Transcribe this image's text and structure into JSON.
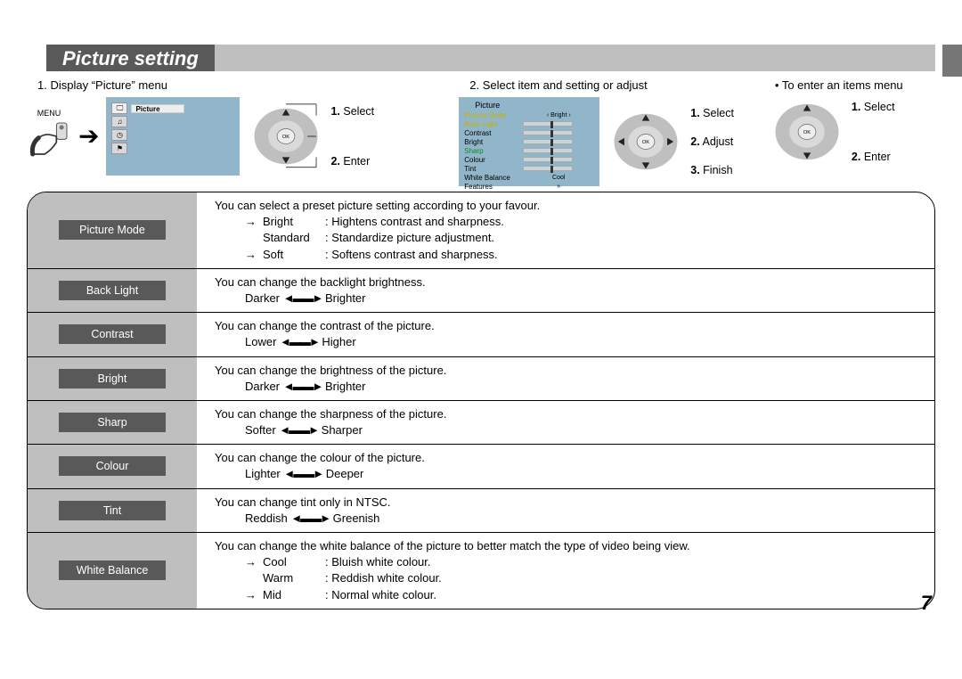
{
  "title": "Picture setting",
  "page_number": "7",
  "step1": {
    "label": "1. Display “Picture” menu",
    "menu_label": "MENU",
    "tv_header": "Picture",
    "dpad1": "1.",
    "dpad1_t": "Select",
    "dpad2": "2.",
    "dpad2_t": "Enter"
  },
  "step2": {
    "label": "2. Select item and setting or adjust",
    "tv_title": "Picture",
    "items": [
      {
        "name": "Picture Mode",
        "val": "Bright",
        "cls": "yellow",
        "type": "val",
        "arrows": true
      },
      {
        "name": "Back Light",
        "cls": "yellow",
        "type": "bar"
      },
      {
        "name": "Contrast",
        "type": "bar"
      },
      {
        "name": "Bright",
        "type": "bar"
      },
      {
        "name": "Sharp",
        "cls": "green",
        "type": "bar"
      },
      {
        "name": "Colour",
        "type": "bar"
      },
      {
        "name": "Tint",
        "type": "bar"
      },
      {
        "name": "White Balance",
        "val": "Cool",
        "type": "val"
      },
      {
        "name": "Features",
        "val": "»",
        "type": "val"
      }
    ],
    "dpadA1": "1.",
    "dpadA1_t": "Select",
    "dpadA2": "2.",
    "dpadA2_t": "Adjust",
    "dpadA3": "3.",
    "dpadA3_t": "Finish"
  },
  "step3": {
    "note": "• To enter an items menu",
    "dpadB1": "1.",
    "dpadB1_t": "Select",
    "dpadB2": "2.",
    "dpadB2_t": "Enter"
  },
  "rows": [
    {
      "name": "Picture Mode",
      "lead": "You can select a preset picture setting according to your favour.",
      "list": [
        {
          "arrow": "→",
          "term": "Bright",
          "desc": ":  Hightens contrast and sharpness."
        },
        {
          "arrow": "",
          "term": "Standard",
          "desc": ":  Standardize picture adjustment."
        },
        {
          "arrow": "→",
          "term": "Soft",
          "desc": ":  Softens contrast and sharpness."
        }
      ]
    },
    {
      "name": "Back Light",
      "lead": "You can change the backlight brightness.",
      "scale": "Darker ↔ Brighter"
    },
    {
      "name": "Contrast",
      "lead": "You can change the contrast of the picture.",
      "scale": "Lower ↔ Higher"
    },
    {
      "name": "Bright",
      "lead": "You can change the brightness of the picture.",
      "scale": "Darker ↔ Brighter"
    },
    {
      "name": "Sharp",
      "lead": "You can change the sharpness of the picture.",
      "scale": "Softer ↔ Sharper"
    },
    {
      "name": "Colour",
      "lead": "You can change the colour of the picture.",
      "scale": "Lighter ↔ Deeper"
    },
    {
      "name": "Tint",
      "lead": "You can change tint only in NTSC.",
      "scale": "Reddish ↔ Greenish"
    },
    {
      "name": "White Balance",
      "lead": "You can change the white balance of the picture to better match the type of video being view.",
      "list": [
        {
          "arrow": "→",
          "term": "Cool",
          "desc": ":  Bluish white colour."
        },
        {
          "arrow": "",
          "term": "Warm",
          "desc": ":  Reddish white colour."
        },
        {
          "arrow": "→",
          "term": "Mid",
          "desc": ":  Normal white colour."
        }
      ]
    }
  ],
  "ok_label": "OK"
}
